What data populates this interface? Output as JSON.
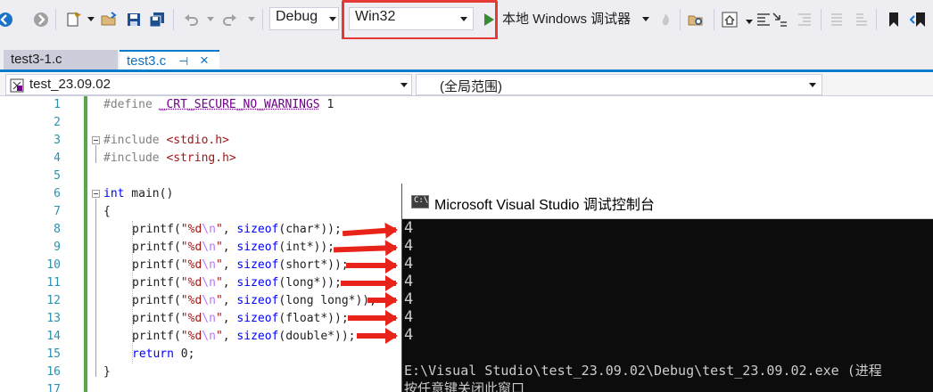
{
  "toolbar": {
    "config": "Debug",
    "platform": "Win32",
    "run_label": "本地 Windows 调试器"
  },
  "tabs": [
    {
      "label": "test3-1.c",
      "active": false
    },
    {
      "label": "test3.c",
      "active": true,
      "pin": "⊣",
      "close": "×"
    }
  ],
  "navbar": {
    "project": "test_23.09.02",
    "scope": "(全局范围)"
  },
  "editor": {
    "line_numbers": [
      "1",
      "2",
      "3",
      "4",
      "5",
      "6",
      "7",
      "8",
      "9",
      "10",
      "11",
      "12",
      "13",
      "14",
      "15",
      "16",
      "17"
    ],
    "lines": {
      "l1": {
        "pp": "#define ",
        "macro": "_CRT_SECURE_NO_WARNINGS",
        "rest": " 1"
      },
      "l3": {
        "pp": "#include ",
        "hdr": "<stdio.h>"
      },
      "l4": {
        "pp": "#include ",
        "hdr": "<string.h>"
      },
      "l6": {
        "kw": "int",
        "rest": " main()"
      },
      "l7": "{",
      "printf_lines": [
        {
          "fn": "printf(",
          "s1": "\"%d",
          "esc": "\\n",
          "s2": "\"",
          "mid": ", ",
          "kw": "sizeof",
          "arg": "(char*));"
        },
        {
          "fn": "printf(",
          "s1": "\"%d",
          "esc": "\\n",
          "s2": "\"",
          "mid": ", ",
          "kw": "sizeof",
          "arg": "(int*));"
        },
        {
          "fn": "printf(",
          "s1": "\"%d",
          "esc": "\\n",
          "s2": "\"",
          "mid": ", ",
          "kw": "sizeof",
          "arg": "(short*));"
        },
        {
          "fn": "printf(",
          "s1": "\"%d",
          "esc": "\\n",
          "s2": "\"",
          "mid": ", ",
          "kw": "sizeof",
          "arg": "(long*));"
        },
        {
          "fn": "printf(",
          "s1": "\"%d",
          "esc": "\\n",
          "s2": "\"",
          "mid": ", ",
          "kw": "sizeof",
          "arg": "(long long*));"
        },
        {
          "fn": "printf(",
          "s1": "\"%d",
          "esc": "\\n",
          "s2": "\"",
          "mid": ", ",
          "kw": "sizeof",
          "arg": "(float*));"
        },
        {
          "fn": "printf(",
          "s1": "\"%d",
          "esc": "\\n",
          "s2": "\"",
          "mid": ", ",
          "kw": "sizeof",
          "arg": "(double*));"
        }
      ],
      "l15": {
        "kw": "return",
        "rest": " 0;"
      },
      "l16": "}"
    }
  },
  "console": {
    "title": "Microsoft Visual Studio 调试控制台",
    "icon_text": "C:\\",
    "outputs": [
      "4",
      "4",
      "4",
      "4",
      "4",
      "4",
      "4"
    ],
    "exit_line": "E:\\Visual Studio\\test_23.09.02\\Debug\\test_23.09.02.exe (进程",
    "press_key": "按任意键关闭此窗口"
  },
  "colors": {
    "accent": "#007acc",
    "highlight_box": "#e53935",
    "arrow": "#e8231a",
    "run_green": "#388a34"
  }
}
